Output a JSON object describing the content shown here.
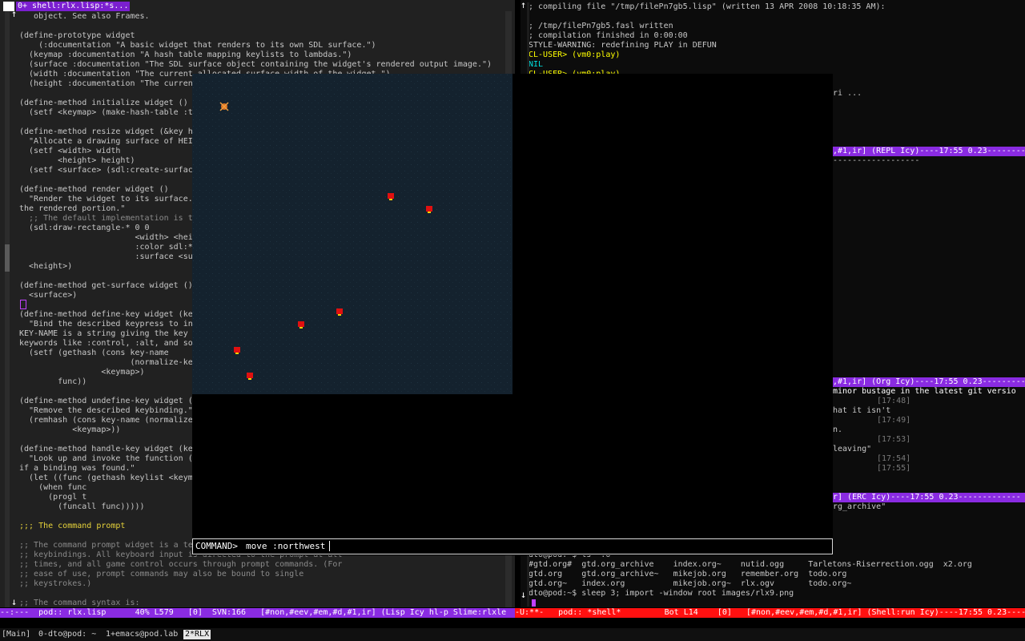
{
  "left": {
    "title": "0+ shell:rlx.lisp:*s...",
    "lines": [
      [
        "   object. See also Frames.",
        "#c8c8c8"
      ],
      [
        "",
        ""
      ],
      [
        "(define-prototype widget",
        "#c8c8c8"
      ],
      [
        "    (:documentation \"A basic widget that renders to its own SDL surface.\")",
        "#c8c8c8"
      ],
      [
        "  (keymap :documentation \"A hash table mapping keylists to lambdas.\")",
        "#c8c8c8"
      ],
      [
        "  (surface :documentation \"The SDL surface object containing the widget's rendered output image.\")",
        "#c8c8c8"
      ],
      [
        "  (width :documentation \"The current allocated surface width of the widget.\")",
        "#c8c8c8"
      ],
      [
        "  (height :documentation \"The current",
        "#c8c8c8"
      ],
      [
        "",
        ""
      ],
      [
        "(define-method initialize widget ()",
        "#c8c8c8"
      ],
      [
        "  (setf <keymap> (make-hash-table :t",
        "#c8c8c8"
      ],
      [
        "",
        ""
      ],
      [
        "(define-method resize widget (&key h",
        "#c8c8c8"
      ],
      [
        "  \"Allocate a drawing surface of HEI",
        "#c8c8c8"
      ],
      [
        "  (setf <width> width",
        "#c8c8c8"
      ],
      [
        "        <height> height)",
        "#c8c8c8"
      ],
      [
        "  (setf <surface> (sdl:create-surfac",
        "#c8c8c8"
      ],
      [
        "",
        ""
      ],
      [
        "(define-method render widget ()",
        "#c8c8c8"
      ],
      [
        "  \"Render the widget to its surface.",
        "#c8c8c8"
      ],
      [
        "the rendered portion.\"",
        "#c8c8c8"
      ],
      [
        "  ;; The default implementation is t",
        "#8a8a8a"
      ],
      [
        "  (sdl:draw-rectangle-* 0 0",
        "#c8c8c8"
      ],
      [
        "                        <width> <hei",
        "#c8c8c8"
      ],
      [
        "                        :color sdl:*",
        "#c8c8c8"
      ],
      [
        "                        :surface <su",
        "#c8c8c8"
      ],
      [
        "  <height>)",
        "#c8c8c8"
      ],
      [
        "",
        ""
      ],
      [
        "(define-method get-surface widget ()",
        "#c8c8c8"
      ],
      [
        "  <surface>)",
        "#c8c8c8"
      ],
      [
        "",
        ""
      ],
      [
        "(define-method define-key widget (ke",
        "#c8c8c8"
      ],
      [
        "  \"Bind the described keypress to in",
        "#c8c8c8"
      ],
      [
        "KEY-NAME is a string giving the key",
        "#c8c8c8"
      ],
      [
        "keywords like :control, :alt, and so",
        "#c8c8c8"
      ],
      [
        "  (setf (gethash (cons key-name",
        "#c8c8c8"
      ],
      [
        "                       (normalize-ke",
        "#c8c8c8"
      ],
      [
        "                 <keymap>)",
        "#c8c8c8"
      ],
      [
        "        func))",
        "#c8c8c8"
      ],
      [
        "",
        ""
      ],
      [
        "(define-method undefine-key widget (",
        "#c8c8c8"
      ],
      [
        "  \"Remove the described keybinding.\"",
        "#c8c8c8"
      ],
      [
        "  (remhash (cons key-name (normalize",
        "#c8c8c8"
      ],
      [
        "           <keymap>))",
        "#c8c8c8"
      ],
      [
        "",
        ""
      ],
      [
        "(define-method handle-key widget (ke",
        "#c8c8c8"
      ],
      [
        "  \"Look up and invoke the function (",
        "#c8c8c8"
      ],
      [
        "if a binding was found.\"",
        "#c8c8c8"
      ],
      [
        "  (let ((func (gethash keylist <keym",
        "#c8c8c8"
      ],
      [
        "    (when func",
        "#c8c8c8"
      ],
      [
        "      (progl t",
        "#c8c8c8"
      ],
      [
        "        (funcall func)))))",
        "#c8c8c8"
      ],
      [
        "",
        ""
      ],
      [
        ";;; The command prompt",
        "#e6d23a"
      ],
      [
        "",
        ""
      ],
      [
        ";; The command prompt widget is a te",
        "#8a8a8a"
      ],
      [
        ";; keybindings. All keyboard input is directed to the prompt at all",
        "#8a8a8a"
      ],
      [
        ";; times, and all game control occurs through prompt commands. (For",
        "#8a8a8a"
      ],
      [
        ";; ease of use, prompt commands may also be bound to single",
        "#8a8a8a"
      ],
      [
        ";; keystrokes.)",
        "#8a8a8a"
      ],
      [
        "",
        ""
      ],
      [
        ";; The command syntax is:",
        "#8a8a8a"
      ]
    ],
    "modeline": "--:---  pod:: rlx.lisp      40% L579   [0]  SVN:166   [#non,#eev,#em,#d,#1,ir] (Lisp Icy hl-p Slime:rlxle"
  },
  "right": {
    "top_lines": [
      [
        "; compiling file \"/tmp/filePn7gb5.lisp\" (written 13 APR 2008 10:18:35 AM):",
        "#c8c8c8"
      ],
      [
        "",
        ""
      ],
      [
        "; /tmp/filePn7gb5.fasl written",
        "#c8c8c8"
      ],
      [
        "; compilation finished in 0:00:00",
        "#c8c8c8"
      ],
      [
        "STYLE-WARNING: redefining PLAY in DEFUN",
        "#c8c8c8"
      ],
      [
        "CL-USER> (vm0:play)",
        "#ffff00"
      ],
      [
        "NIL",
        "#00e0e0"
      ],
      [
        "CL-USER> (vm0:play)",
        "#ffff00"
      ]
    ],
    "repl_fragment": "ri ...",
    "repl_modeline": ",#1,ir] (REPL Icy)----17:55 0.23---------",
    "repl_dashes": "------------------",
    "org_modeline": ",#1,ir] (Org Icy)----17:55 0.23----------",
    "erc_lines": [
      [
        "minor bustage in the latest git versio",
        "#ffffff"
      ],
      [
        "[17:48]",
        "#7a7a7a"
      ],
      [
        "hat it isn't",
        "#c8c8c8"
      ],
      [
        "[17:49]",
        "#7a7a7a"
      ],
      [
        "n.",
        "#c8c8c8"
      ],
      [
        "[17:53]",
        "#7a7a7a"
      ],
      [
        "leaving\"",
        "#c8c8c8"
      ],
      [
        "[17:54]",
        "#7a7a7a"
      ],
      [
        "[17:55]",
        "#7a7a7a"
      ]
    ],
    "erc_modeline": "r] (ERC Icy)----17:55 0.23-------------",
    "erc_fragment": "rg_archive\"",
    "shell_lines": [
      "dto@pod:~$ ls *.o*",
      "#gtd.org#  gtd.org_archive    index.org~    nutid.ogg     Tarletons-Riserrection.ogg  x2.org",
      "gtd.org    gtd.org_archive~   mikejob.org   remember.org  todo.org",
      "gtd.org~   index.org          mikejob.org~  rlx.ogv       todo.org~",
      "dto@pod:~$ sleep 3; import -window root images/rlx9.png"
    ],
    "shell_modeline": "-U:**-   pod:: *shell*         Bot L14    [0]   [#non,#eev,#em,#d,#1,ir] (Shell:run Icy)----17:55 0.23---------"
  },
  "game": {
    "command_prompt": "COMMAND>",
    "command_text": "move :northwest",
    "player_icon": "player-sprite-icon",
    "enemy_icon": "red-creature-icon"
  },
  "statusbar": {
    "items": [
      "[Main]",
      "0-dto@pod: ~",
      "1+emacs@pod.lab",
      "2*RLX"
    ],
    "selected": "2*RLX"
  },
  "colors": {
    "modeline_purple": "#8a2be2",
    "modeline_red": "#ff1010",
    "comment": "#8a8a8a",
    "keyword": "#f0d000",
    "game_bg": "#14222e"
  }
}
